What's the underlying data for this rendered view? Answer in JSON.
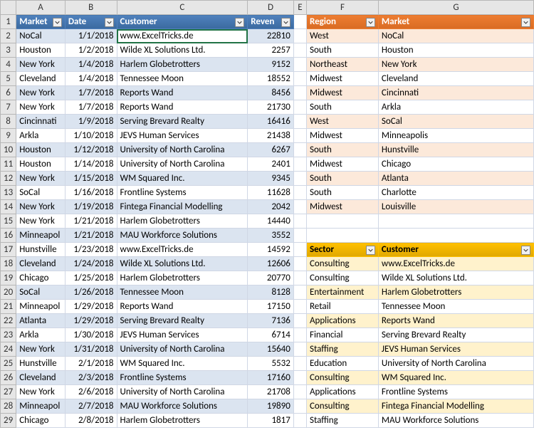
{
  "columns": [
    "A",
    "B",
    "C",
    "D",
    "E",
    "F",
    "G"
  ],
  "table1": {
    "headers": [
      "Market",
      "Date",
      "Customer",
      "Reven"
    ],
    "rows": [
      [
        "NoCal",
        "1/1/2018",
        "www.ExcelTricks.de",
        "22810"
      ],
      [
        "Houston",
        "1/2/2018",
        "Wilde XL Solutions Ltd.",
        "2257"
      ],
      [
        "New York",
        "1/4/2018",
        "Harlem Globetrotters",
        "9152"
      ],
      [
        "Cleveland",
        "1/4/2018",
        "Tennessee Moon",
        "18552"
      ],
      [
        "New York",
        "1/7/2018",
        "Reports Wand",
        "8456"
      ],
      [
        "New York",
        "1/7/2018",
        "Reports Wand",
        "21730"
      ],
      [
        "Cincinnati",
        "1/9/2018",
        "Serving Brevard Realty",
        "16416"
      ],
      [
        "Arkla",
        "1/10/2018",
        "JEVS Human Services",
        "21438"
      ],
      [
        "Houston",
        "1/12/2018",
        "University of North Carolina",
        "6267"
      ],
      [
        "Houston",
        "1/14/2018",
        "University of North Carolina",
        "2401"
      ],
      [
        "New York",
        "1/15/2018",
        "WM Squared Inc.",
        "9345"
      ],
      [
        "SoCal",
        "1/16/2018",
        "Frontline Systems",
        "11628"
      ],
      [
        "New York",
        "1/19/2018",
        "Fintega Financial Modelling",
        "2042"
      ],
      [
        "New York",
        "1/21/2018",
        "Harlem Globetrotters",
        "14440"
      ],
      [
        "Minneapol",
        "1/21/2018",
        "MAU Workforce Solutions",
        "3552"
      ],
      [
        "Hunstville",
        "1/23/2018",
        "www.ExcelTricks.de",
        "14592"
      ],
      [
        "Cleveland",
        "1/24/2018",
        "Wilde XL Solutions Ltd.",
        "12606"
      ],
      [
        "Chicago",
        "1/25/2018",
        "Harlem Globetrotters",
        "20770"
      ],
      [
        "SoCal",
        "1/26/2018",
        "Tennessee Moon",
        "8128"
      ],
      [
        "Minneapol",
        "1/29/2018",
        "Reports Wand",
        "17150"
      ],
      [
        "Atlanta",
        "1/29/2018",
        "Serving Brevard Realty",
        "7136"
      ],
      [
        "Arkla",
        "1/30/2018",
        "JEVS Human Services",
        "6714"
      ],
      [
        "New York",
        "1/31/2018",
        "University of North Carolina",
        "15640"
      ],
      [
        "Hunstville",
        "2/1/2018",
        "WM Squared Inc.",
        "5532"
      ],
      [
        "Cleveland",
        "2/3/2018",
        "Frontline Systems",
        "17160"
      ],
      [
        "New York",
        "2/6/2018",
        "University of North Carolina",
        "21708"
      ],
      [
        "Minneapol",
        "2/7/2018",
        "MAU Workforce Solutions",
        "19890"
      ],
      [
        "Chicago",
        "2/8/2018",
        "Harlem Globetrotters",
        "1817"
      ]
    ]
  },
  "table2": {
    "headers": [
      "Region",
      "Market"
    ],
    "rows": [
      [
        "West",
        "NoCal"
      ],
      [
        "South",
        "Houston"
      ],
      [
        "Northeast",
        "New York"
      ],
      [
        "Midwest",
        "Cleveland"
      ],
      [
        "Midwest",
        "Cincinnati"
      ],
      [
        "South",
        "Arkla"
      ],
      [
        "West",
        "SoCal"
      ],
      [
        "Midwest",
        "Minneapolis"
      ],
      [
        "South",
        "Hunstville"
      ],
      [
        "Midwest",
        "Chicago"
      ],
      [
        "South",
        "Atlanta"
      ],
      [
        "South",
        "Charlotte"
      ],
      [
        "Midwest",
        "Louisville"
      ]
    ]
  },
  "table3": {
    "headers": [
      "Sector",
      "Customer"
    ],
    "rows": [
      [
        "Consulting",
        "www.ExcelTricks.de"
      ],
      [
        "Consulting",
        "Wilde XL Solutions Ltd."
      ],
      [
        "Entertainment",
        "Harlem Globetrotters"
      ],
      [
        "Retail",
        "Tennessee Moon"
      ],
      [
        "Applications",
        "Reports Wand"
      ],
      [
        "Financial",
        "Serving Brevard Realty"
      ],
      [
        "Staffing",
        "JEVS Human Services"
      ],
      [
        "Education",
        "University of North Carolina"
      ],
      [
        "Consulting",
        "WM Squared Inc."
      ],
      [
        "Applications",
        "Frontline Systems"
      ],
      [
        "Consulting",
        "Fintega Financial Modelling"
      ],
      [
        "Staffing",
        "MAU Workforce Solutions"
      ]
    ]
  },
  "selected_cell": "C2"
}
